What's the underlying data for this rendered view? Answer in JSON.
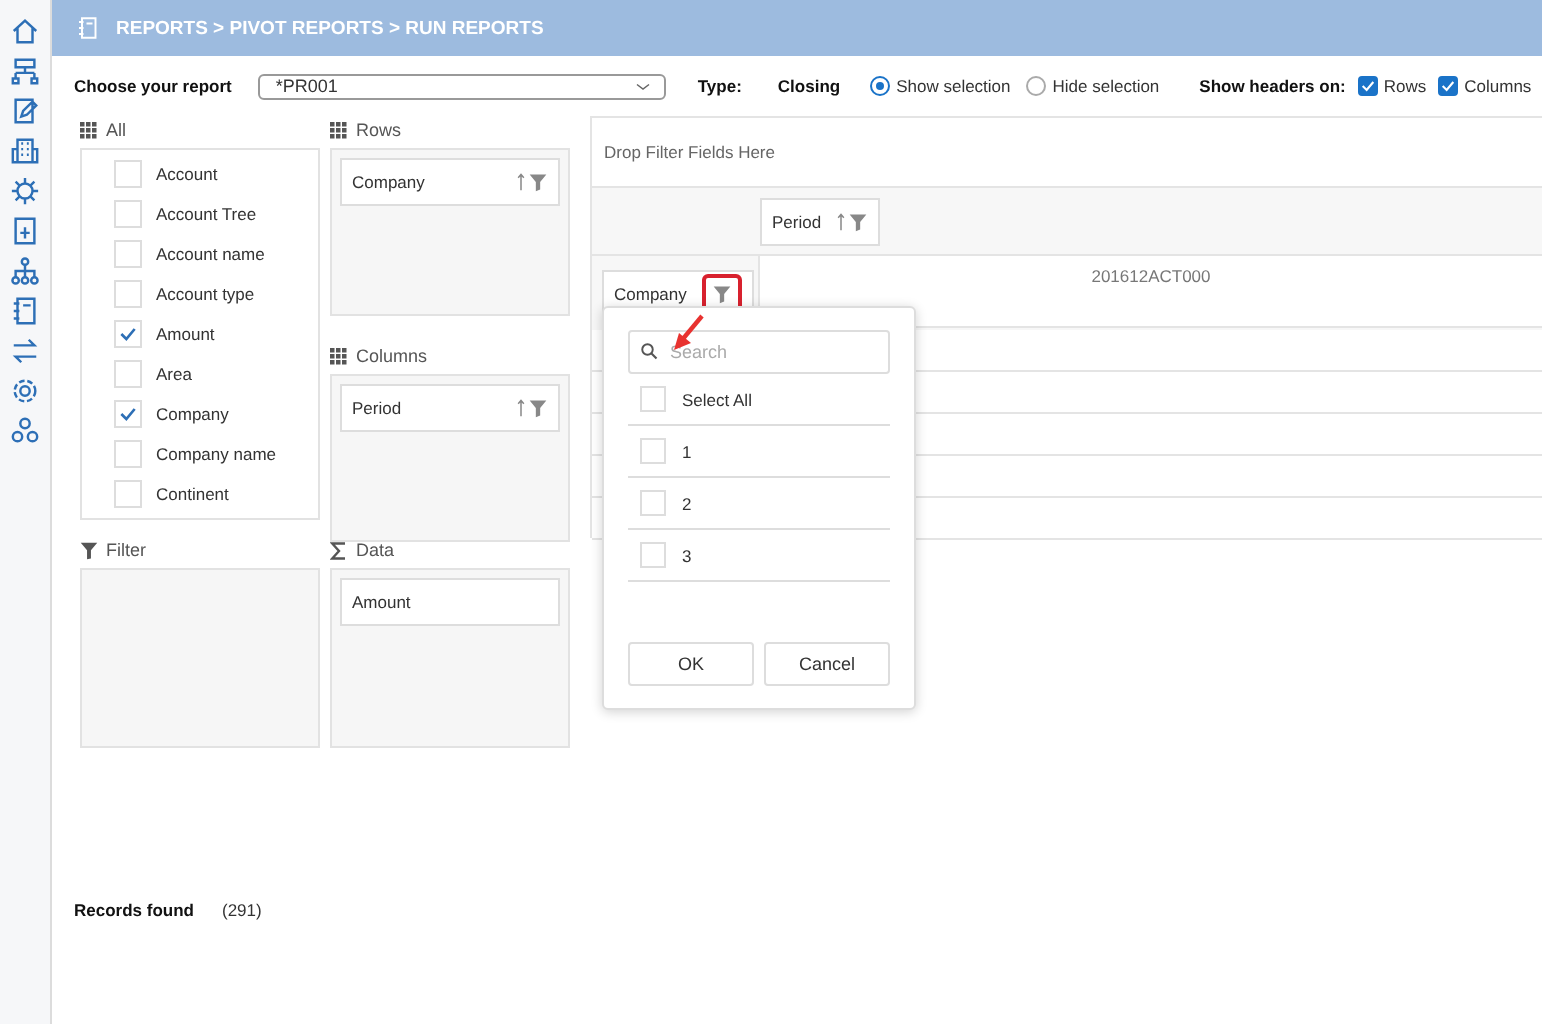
{
  "breadcrumb": "REPORTS > PIVOT REPORTS > RUN REPORTS",
  "report": {
    "label": "Choose your report",
    "value": "*PR001"
  },
  "type": {
    "label": "Type:",
    "value": "Closing"
  },
  "selection_options": [
    {
      "label": "Show selection",
      "selected": true
    },
    {
      "label": "Hide selection",
      "selected": false
    }
  ],
  "headers": {
    "label": "Show headers on:",
    "options": [
      {
        "label": "Rows",
        "checked": true
      },
      {
        "label": "Columns",
        "checked": true
      }
    ]
  },
  "panels": [
    {
      "kind": "all",
      "title": "All",
      "items": [
        {
          "label": "Account",
          "checked": false
        },
        {
          "label": "Account Tree",
          "checked": false
        },
        {
          "label": "Account name",
          "checked": false
        },
        {
          "label": "Account type",
          "checked": false
        },
        {
          "label": "Amount",
          "checked": true
        },
        {
          "label": "Area",
          "checked": false
        },
        {
          "label": "Company",
          "checked": true
        },
        {
          "label": "Company name",
          "checked": false
        },
        {
          "label": "Continent",
          "checked": false
        }
      ]
    },
    {
      "kind": "rows",
      "title": "Rows",
      "fields": [
        "Company"
      ]
    },
    {
      "kind": "columns",
      "title": "Columns",
      "fields": [
        "Period"
      ]
    },
    {
      "kind": "filter",
      "title": "Filter"
    },
    {
      "kind": "data",
      "title": "Data",
      "fields": [
        "Amount"
      ]
    }
  ],
  "pivot": {
    "drop_hint": "Drop Filter Fields Here",
    "column_header": "Period",
    "row_header": "Company",
    "row_filter_highlighted": true,
    "column_value": "201612ACT000"
  },
  "filter_popup": {
    "placeholder": "Search",
    "items": [
      {
        "label": "Select All",
        "checked": false
      },
      {
        "label": "1",
        "checked": false
      },
      {
        "label": "2",
        "checked": false
      },
      {
        "label": "3",
        "checked": false
      }
    ],
    "buttons": [
      "OK",
      "Cancel"
    ]
  },
  "records": {
    "label": "Records found",
    "count": "(291)"
  }
}
